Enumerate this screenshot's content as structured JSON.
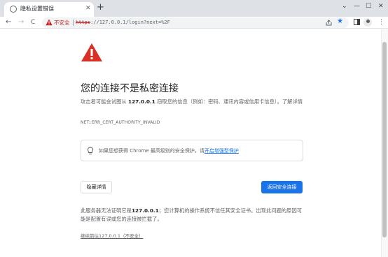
{
  "browser": {
    "tab": {
      "title": "隐私设置错误",
      "close_glyph": "✕"
    },
    "new_tab_glyph": "+",
    "window_controls": {
      "dropdown": "⌄",
      "minimize": "—",
      "maximize": "☐",
      "close": "✕"
    },
    "nav": {
      "back": "←",
      "forward": "→",
      "reload": "C"
    },
    "address_bar": {
      "security_label": "不安全",
      "url_scheme": "https",
      "url_rest": "://127.0.0.1/login?next=%2F"
    },
    "icons": [
      "share-icon",
      "star-icon",
      "side-panel-icon",
      "profile-icon",
      "menu-icon"
    ]
  },
  "page": {
    "heading": "您的连接不是私密连接",
    "description": {
      "before": "攻击者可能会试图从 ",
      "host": "127.0.0.1",
      "after": " 窃取您的信息（例如：密码、通讯内容或信用卡信息）。",
      "learn_more": "了解详情"
    },
    "error_code": "NET::ERR_CERT_AUTHORITY_INVALID",
    "promo": {
      "text": "如果您想获得 Chrome 最高级别的安全保护，请",
      "link": "开启增强型保护"
    },
    "buttons": {
      "details": "隐藏详情",
      "back": "返回安全连接"
    },
    "details": {
      "before": "此服务器无法证明它是",
      "host": "127.0.0.1",
      "after": "；您计算机的操作系统不信任其安全证书。出现此问题的原因可能是配置有误或您的连接被拦截了。"
    },
    "proceed_link": "继续前往127.0.0.1（不安全）"
  },
  "colors": {
    "tab_strip": "#dee1e6",
    "danger": "#c5221f",
    "warning_triangle": "#d93025",
    "accent": "#1a73e8",
    "text_primary": "#202124",
    "text_secondary": "#5f6368"
  }
}
